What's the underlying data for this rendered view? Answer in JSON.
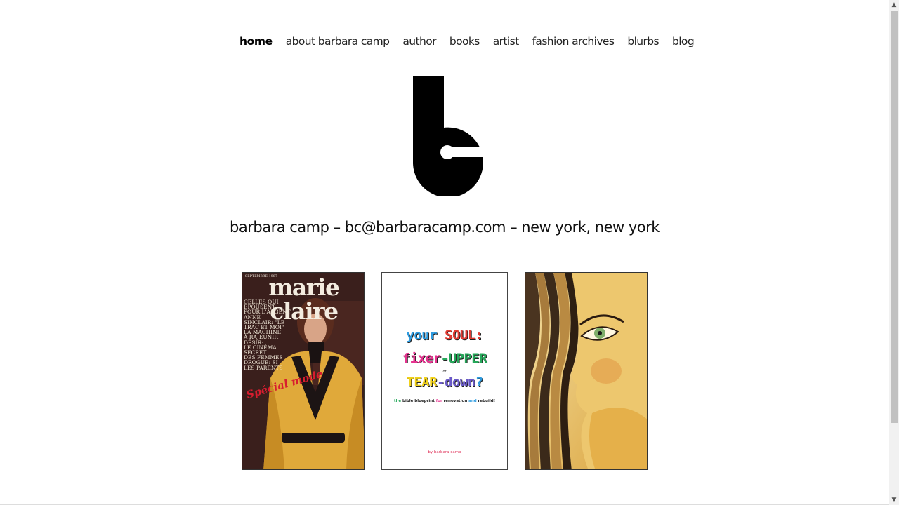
{
  "nav": {
    "items": [
      {
        "label": "home",
        "active": true
      },
      {
        "label": "about barbara camp"
      },
      {
        "label": "author"
      },
      {
        "label": "books"
      },
      {
        "label": "artist"
      },
      {
        "label": "fashion archives"
      },
      {
        "label": "blurbs"
      },
      {
        "label": "blog"
      }
    ]
  },
  "logo": {
    "alt": "bc logo"
  },
  "contact": {
    "text": "barbara camp – bc@barbaracamp.com – new york, new york"
  },
  "gallery": {
    "magazine": {
      "title": "marie claire",
      "month": "SEPTEMBRE 1987",
      "cover_lines": "CELLES QUI\nÉPOUSENT\nPOUR L'ARGENT\nANNE\nSINCLAIR: \"LE\nTRAC ET MOI\"\nLA MACHINE\nÀ RAJEUNIR\nDÉSIR:\nLE CINÉMA\nSECRET\nDES FEMMES\nDROGUE: SI\nLES PARENTS",
      "special": "Spécial mode",
      "colors": {
        "bg": "#3a1f1c",
        "coat": "#e0a93a",
        "title": "#f3ece0"
      }
    },
    "book": {
      "line1_a": "your",
      "line1_b": "SOUL:",
      "line2_a": "fixer",
      "line2_b": "-UPPER",
      "or": "or",
      "line3_a": "TEAR",
      "line3_b": "-down",
      "line3_c": "?",
      "subtitle_a": "the",
      "subtitle_b": "bible blueprint",
      "subtitle_c": "for",
      "subtitle_d": "renovation",
      "subtitle_e": "and",
      "subtitle_f": "rebuild!",
      "byline": "by barbara camp",
      "colors": {
        "blue": "#2d9be0",
        "red": "#e23b33",
        "magenta": "#e6328f",
        "green": "#25a85a",
        "yellow": "#f2d21a",
        "purple": "#6a5ac8"
      }
    },
    "painting": {
      "colors": {
        "light": "#f3dc98",
        "mid": "#e2b24a",
        "dark": "#3b2a1a",
        "eye": "#7fae6a"
      }
    }
  },
  "scrollbar": {
    "up_icon": "scroll-up-arrow",
    "down_icon": "scroll-down-arrow"
  }
}
